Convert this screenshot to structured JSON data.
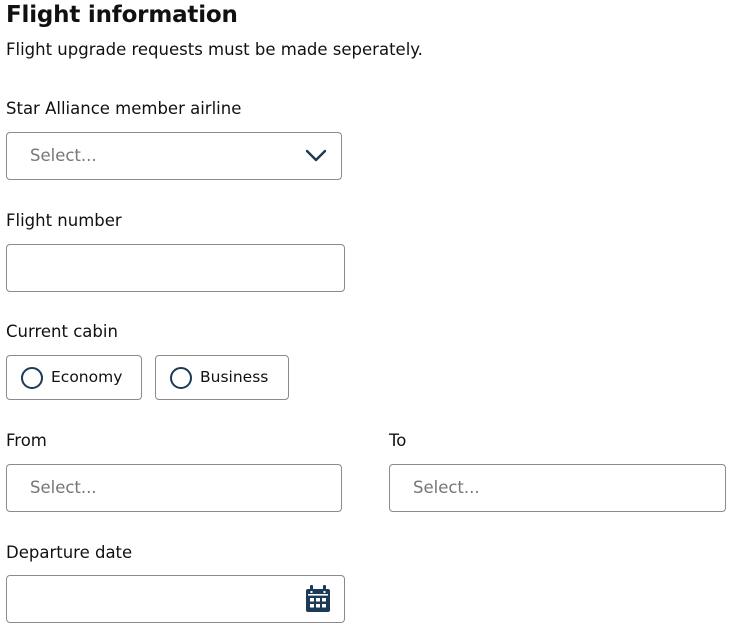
{
  "form": {
    "title": "Flight information",
    "subtitle": "Flight upgrade requests must be made seperately."
  },
  "airline": {
    "label": "Star Alliance member airline",
    "placeholder": "Select...",
    "icon": "chevron-down-icon"
  },
  "flight_number": {
    "label": "Flight number",
    "value": ""
  },
  "cabin": {
    "label": "Current cabin",
    "options": [
      {
        "label": "Economy",
        "selected": false
      },
      {
        "label": "Business",
        "selected": false
      }
    ]
  },
  "from": {
    "label": "From",
    "placeholder": "Select..."
  },
  "to": {
    "label": "To",
    "placeholder": "Select..."
  },
  "departure_date": {
    "label": "Departure date",
    "value": "",
    "icon": "calendar-icon"
  },
  "colors": {
    "icon": "#1b3a57",
    "border": "#8a8a8a",
    "placeholder": "#767676"
  }
}
